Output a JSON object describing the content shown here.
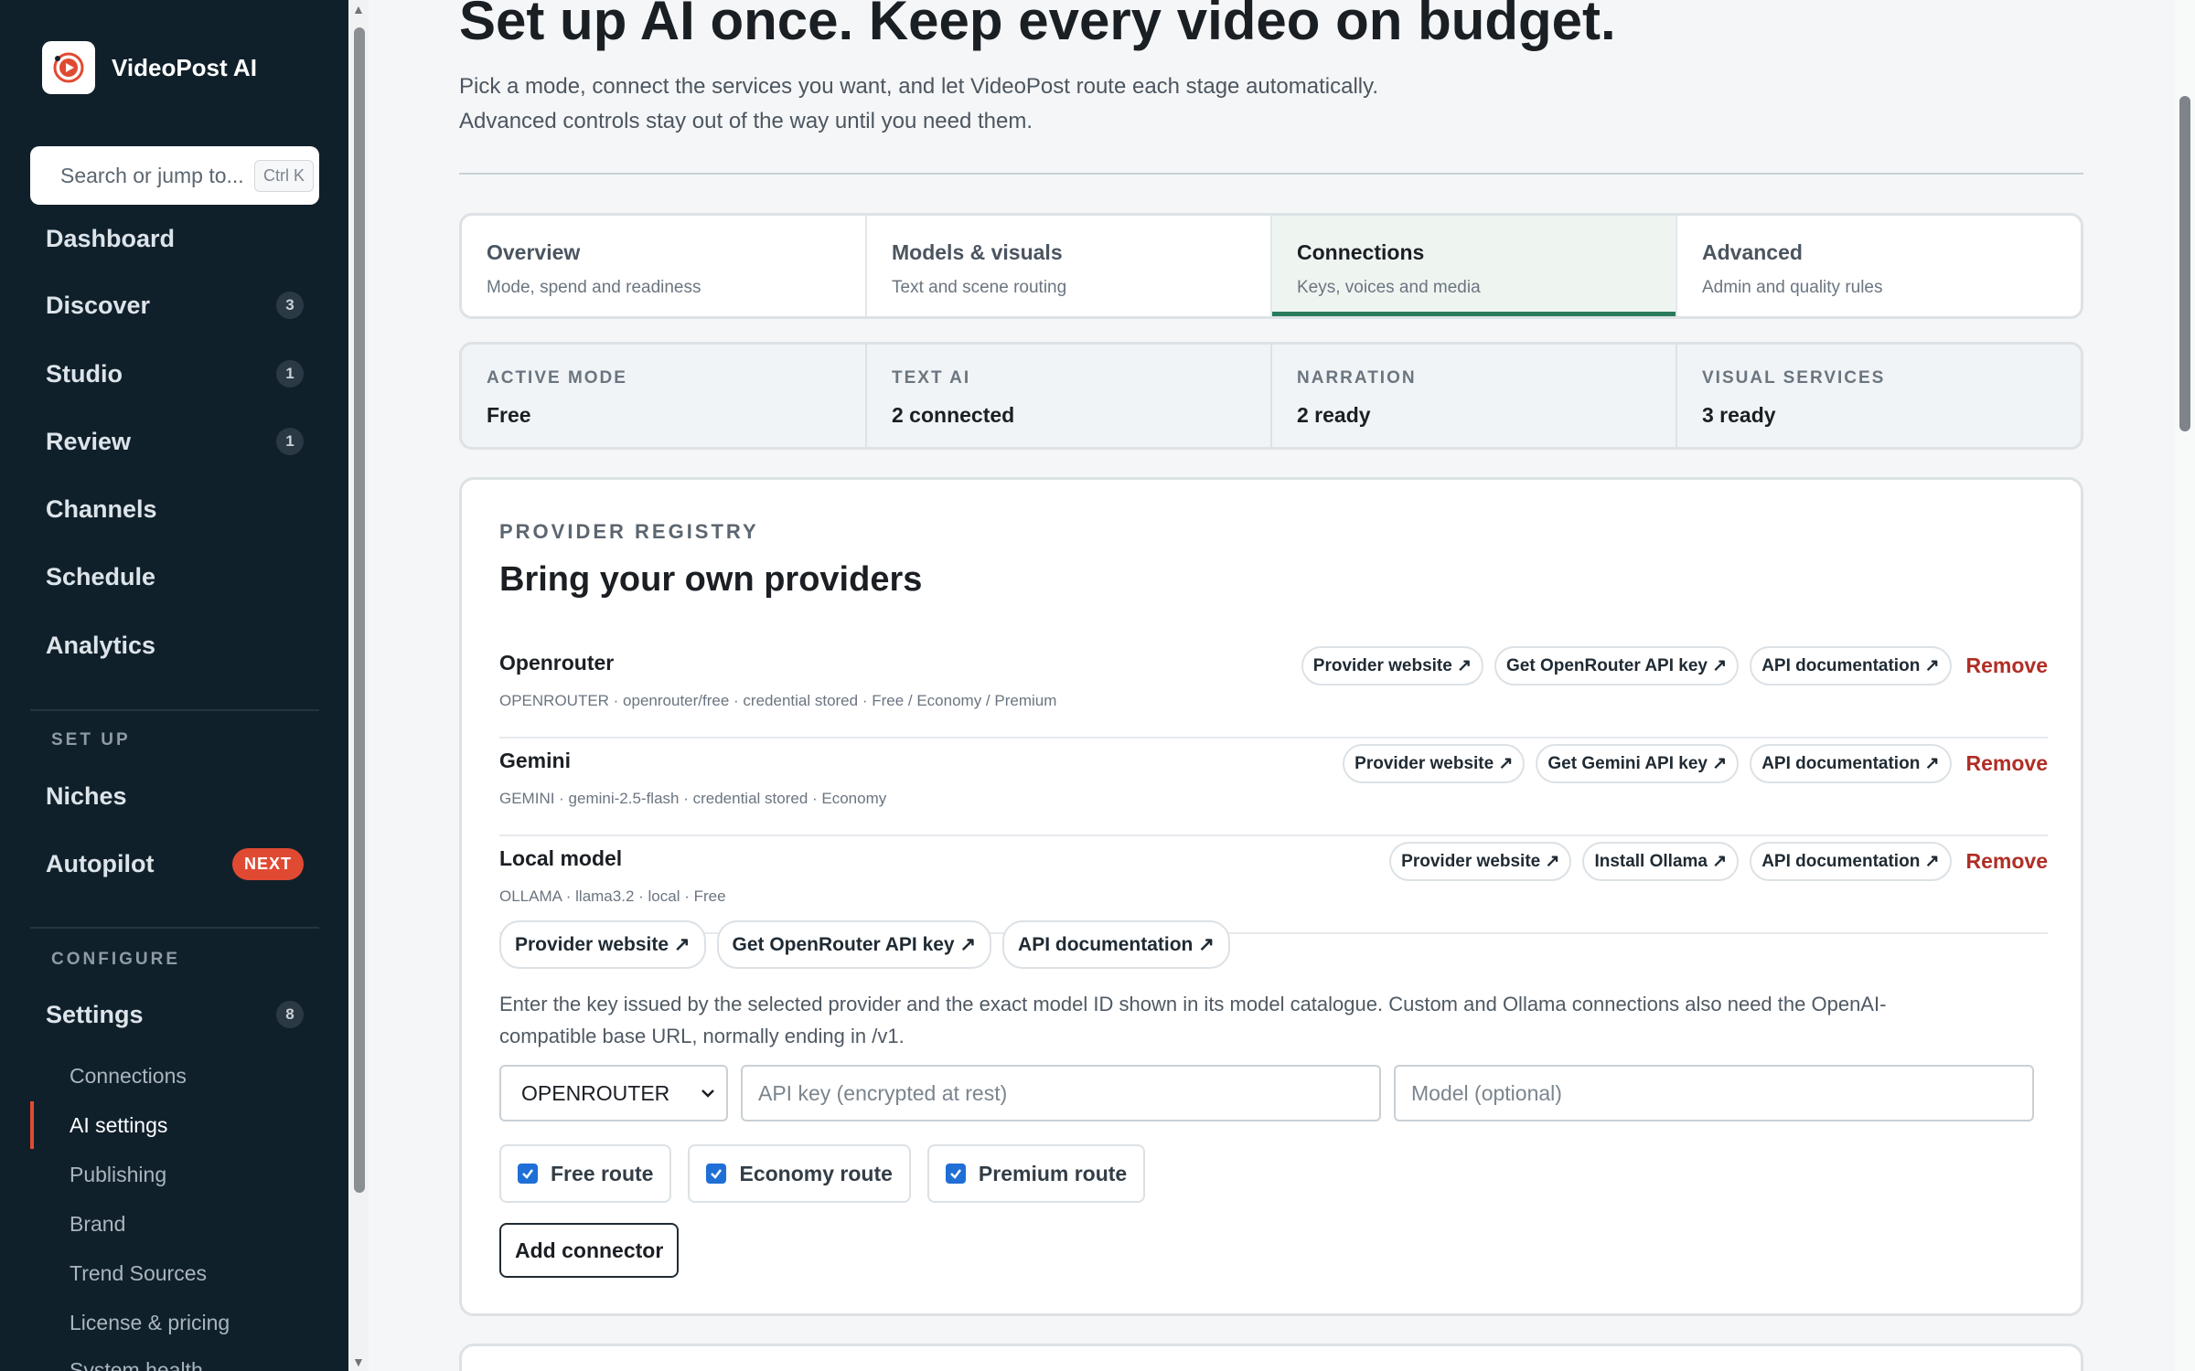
{
  "brand": {
    "name": "VideoPost AI"
  },
  "search": {
    "placeholder": "Search or jump to...",
    "shortcut": "Ctrl K"
  },
  "nav": {
    "items": [
      {
        "label": "Dashboard",
        "count": ""
      },
      {
        "label": "Discover",
        "count": "3"
      },
      {
        "label": "Studio",
        "count": "1"
      },
      {
        "label": "Review",
        "count": "1"
      },
      {
        "label": "Channels",
        "count": ""
      },
      {
        "label": "Schedule",
        "count": ""
      },
      {
        "label": "Analytics",
        "count": ""
      }
    ],
    "setup_label": "SET UP",
    "setup_items": [
      {
        "label": "Niches"
      },
      {
        "label": "Autopilot",
        "badge": "NEXT"
      }
    ],
    "configure_label": "CONFIGURE",
    "settings": {
      "label": "Settings",
      "count": "8"
    },
    "sub_items": [
      "Connections",
      "AI settings",
      "Publishing",
      "Brand",
      "Trend Sources",
      "License & pricing",
      "System health"
    ],
    "active_sub": "AI settings"
  },
  "hero": {
    "title": "Set up AI once. Keep every video on budget.",
    "subtitle_1": "Pick a mode, connect the services you want, and let VideoPost route each stage automatically.",
    "subtitle_2": "Advanced controls stay out of the way until you need them."
  },
  "tabs": [
    {
      "title": "Overview",
      "sub": "Mode, spend and readiness"
    },
    {
      "title": "Models & visuals",
      "sub": "Text and scene routing"
    },
    {
      "title": "Connections",
      "sub": "Keys, voices and media",
      "active": true
    },
    {
      "title": "Advanced",
      "sub": "Admin and quality rules"
    }
  ],
  "stats": [
    {
      "label": "ACTIVE MODE",
      "value": "Free"
    },
    {
      "label": "TEXT AI",
      "value": "2 connected"
    },
    {
      "label": "NARRATION",
      "value": "2 ready"
    },
    {
      "label": "VISUAL SERVICES",
      "value": "3 ready"
    }
  ],
  "registry": {
    "eyebrow": "PROVIDER REGISTRY",
    "title": "Bring your own providers",
    "providers": [
      {
        "name": "Openrouter",
        "meta": "OPENROUTER · openrouter/free · credential stored · Free / Economy / Premium",
        "links": [
          "Provider website ↗",
          "Get OpenRouter API key ↗",
          "API documentation ↗"
        ],
        "remove": "Remove"
      },
      {
        "name": "Gemini",
        "meta": "GEMINI · gemini-2.5-flash · credential stored · Economy",
        "links": [
          "Provider website ↗",
          "Get Gemini API key ↗",
          "API documentation ↗"
        ],
        "remove": "Remove"
      },
      {
        "name": "Local model",
        "meta": "OLLAMA · llama3.2 · local · Free",
        "links": [
          "Provider website ↗",
          "Install Ollama ↗",
          "API documentation ↗"
        ],
        "remove": "Remove"
      }
    ],
    "form": {
      "links": [
        "Provider website ↗",
        "Get OpenRouter API key ↗",
        "API documentation ↗"
      ],
      "help": "Enter the key issued by the selected provider and the exact model ID shown in its model catalogue. Custom and Ollama connections also need the OpenAI-compatible base URL, normally ending in /v1.",
      "provider_select": "OPENROUTER",
      "api_key_placeholder": "API key (encrypted at rest)",
      "model_placeholder": "Model (optional)",
      "routes": [
        {
          "label": "Free route",
          "checked": true
        },
        {
          "label": "Economy route",
          "checked": true
        },
        {
          "label": "Premium route",
          "checked": true
        }
      ],
      "add_button": "Add connector"
    }
  },
  "colors": {
    "sidebar_bg": "#10202b",
    "accent_red": "#e04a32",
    "active_tab_green": "#2b7a5c",
    "remove_red": "#b02e26",
    "checkbox_blue": "#1f6fd6"
  }
}
